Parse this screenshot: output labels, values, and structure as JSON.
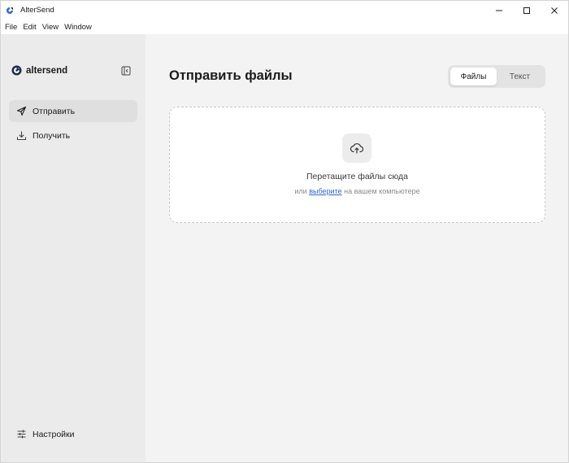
{
  "window": {
    "title": "AlterSend"
  },
  "menubar": {
    "items": [
      "File",
      "Edit",
      "View",
      "Window"
    ]
  },
  "sidebar": {
    "brand": "altersend",
    "nav": [
      {
        "label": "Отправить",
        "icon": "send-icon",
        "active": true
      },
      {
        "label": "Получить",
        "icon": "download-icon",
        "active": false
      }
    ],
    "settings_label": "Настройки"
  },
  "main": {
    "title": "Отправить файлы",
    "tabs": [
      {
        "label": "Файлы",
        "active": true
      },
      {
        "label": "Текст",
        "active": false
      }
    ],
    "dropzone": {
      "title": "Перетащите файлы сюда",
      "sub_before": "или",
      "sub_link": "выберите",
      "sub_after": "на вашем компьютере"
    }
  },
  "colors": {
    "accent": "#3563d8",
    "sidebar_bg": "#ebebeb",
    "main_bg": "#f3f3f3"
  }
}
